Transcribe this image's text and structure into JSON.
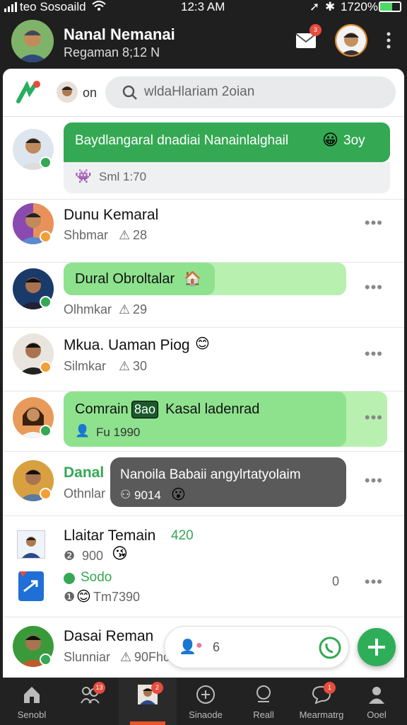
{
  "status_bar": {
    "carrier": "teo Sosoaild",
    "time": "12:3 AM",
    "battery": "1720%"
  },
  "header": {
    "name": "Nanal Nemanai",
    "subtitle": "Regaman  8;12 N",
    "mail_badge": "3"
  },
  "search": {
    "on_label": "on",
    "placeholder": "wldaHlariam 2oian"
  },
  "chats": [
    {
      "message": "Baydlangaral dnadiai Nanainlalghail",
      "message_suffix": "3oy",
      "meta": "Sml 1:70"
    },
    {
      "name": "Dunu Kemaral",
      "sub": "Shbmar",
      "sub_count": "28"
    },
    {
      "bubble": "Dural Obroltalar",
      "sub": "Olhmkar",
      "sub_count": "29"
    },
    {
      "name": "Mkua. Uaman Piog",
      "sub": "Silmkar",
      "sub_count": "30"
    },
    {
      "bubble_pre": "Comrain",
      "bubble_tag": "8ao",
      "bubble_post": "Kasal ladenrad",
      "meta": "Fu 1990"
    },
    {
      "name": "Danal",
      "sub": "Othnlar",
      "tooltip": "Nanoila Babaii angylrtatyolaim",
      "tooltip_meta": "9014"
    },
    {
      "name": "Llaitar Temain",
      "name_count": "420",
      "line1": "900",
      "line2_label": "Sodo",
      "line3": "Tm7390",
      "count": "0"
    },
    {
      "name": "Dasai Reman",
      "sub": "Slunniar",
      "sub_count": "90Fhc",
      "compose_count": "6"
    }
  ],
  "nav": [
    {
      "label": "Senobl",
      "icon": "home-icon",
      "badge": ""
    },
    {
      "label": "",
      "icon": "people-icon",
      "badge": "13"
    },
    {
      "label": "",
      "icon": "profile-icon",
      "badge": "2"
    },
    {
      "label": "Sinaode",
      "icon": "add-circle-icon",
      "badge": ""
    },
    {
      "label": "Reall",
      "icon": "search-icon",
      "badge": ""
    },
    {
      "label": "Mearmatrg",
      "icon": "chat-icon",
      "badge": "1"
    },
    {
      "label": "Ooel",
      "icon": "person-icon",
      "badge": ""
    }
  ],
  "colors": {
    "accent": "#34a853",
    "bubble_green": "#8ee28e",
    "header_bg": "#1f1f1f",
    "badge_red": "#e74c3c"
  }
}
